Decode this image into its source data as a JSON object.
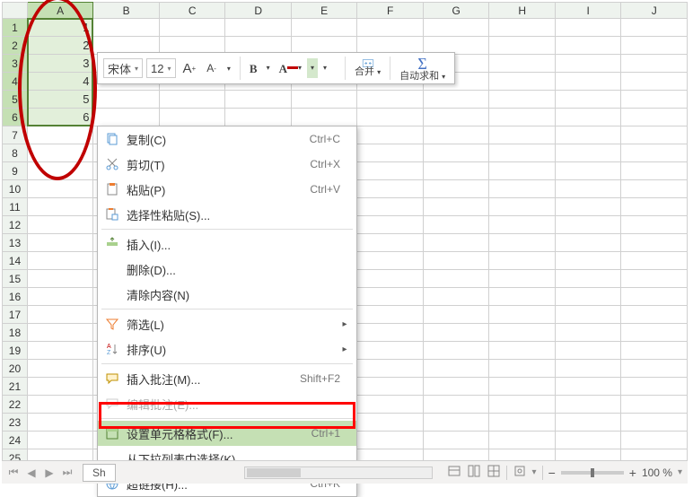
{
  "columns": [
    "A",
    "B",
    "C",
    "D",
    "E",
    "F",
    "G",
    "H",
    "I",
    "J"
  ],
  "row_count": 25,
  "cell_values": {
    "A1": "1",
    "A2": "2",
    "A3": "3",
    "A4": "4",
    "A5": "5",
    "A6": "6"
  },
  "selected_column": "A",
  "selected_rows": [
    1,
    2,
    3,
    4,
    5,
    6
  ],
  "mini_toolbar": {
    "font_name": "宋体",
    "font_size": "12",
    "merge_label": "合并",
    "autosum_label": "自动求和"
  },
  "context_menu": {
    "copy": {
      "label": "复制(C)",
      "shortcut": "Ctrl+C"
    },
    "cut": {
      "label": "剪切(T)",
      "shortcut": "Ctrl+X"
    },
    "paste": {
      "label": "粘贴(P)",
      "shortcut": "Ctrl+V"
    },
    "paste_special": {
      "label": "选择性粘贴(S)..."
    },
    "insert": {
      "label": "插入(I)..."
    },
    "delete": {
      "label": "删除(D)..."
    },
    "clear": {
      "label": "清除内容(N)"
    },
    "filter": {
      "label": "筛选(L)"
    },
    "sort": {
      "label": "排序(U)"
    },
    "comment_add": {
      "label": "插入批注(M)...",
      "shortcut": "Shift+F2"
    },
    "comment_edit": {
      "label": "编辑批注(E)..."
    },
    "format_cells": {
      "label": "设置单元格格式(F)...",
      "shortcut": "Ctrl+1"
    },
    "pick_list": {
      "label": "从下拉列表中选择(K)..."
    },
    "hyperlink": {
      "label": "超链接(H)...",
      "shortcut": "Ctrl+K"
    }
  },
  "status_bar": {
    "sheet_tab": "Sh",
    "zoom": "100 %"
  }
}
